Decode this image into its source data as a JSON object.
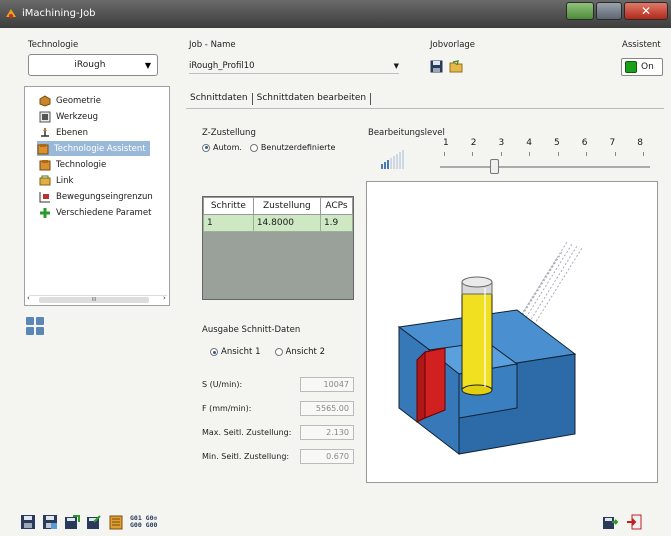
{
  "window": {
    "title": "iMachining-Job"
  },
  "technologie": {
    "label": "Technologie",
    "value": "iRough"
  },
  "job": {
    "label": "Job - Name",
    "value": "iRough_Profil10"
  },
  "jobvorlage": {
    "label": "Jobvorlage"
  },
  "assistent": {
    "label": "Assistent",
    "toggle_text": "On"
  },
  "tree": {
    "items": [
      {
        "label": "Geometrie",
        "icon": "geometry-icon"
      },
      {
        "label": "Werkzeug",
        "icon": "tool-icon"
      },
      {
        "label": "Ebenen",
        "icon": "planes-icon"
      },
      {
        "label": "Technologie Assistent",
        "icon": "tech-assistant-icon"
      },
      {
        "label": "Technologie",
        "icon": "technology-icon"
      },
      {
        "label": "Link",
        "icon": "link-icon"
      },
      {
        "label": "Bewegungseingrenzun",
        "icon": "motion-limit-icon"
      },
      {
        "label": "Verschiedene Paramet",
        "icon": "misc-params-icon"
      }
    ],
    "selected_index": 3,
    "scroll_label": "III"
  },
  "tabs": [
    {
      "label": "Schnittdaten"
    },
    {
      "label": "Schnittdaten bearbeiten"
    }
  ],
  "z_zustellung": {
    "label": "Z-Zustellung",
    "options": [
      "Autom.",
      "Benutzerdefinierte"
    ],
    "selected": "Autom."
  },
  "bearbeitungslevel": {
    "label": "Bearbeitungslevel",
    "levels": [
      "1",
      "2",
      "3",
      "4",
      "5",
      "6",
      "7",
      "8"
    ],
    "value": 3
  },
  "table": {
    "headers": [
      "Schritte",
      "Zustellung",
      "ACPs"
    ],
    "rows": [
      [
        "1",
        "14.8000",
        "1.9"
      ]
    ]
  },
  "ausgabe": {
    "label": "Ausgabe Schnitt-Daten",
    "options": [
      "Ansicht 1",
      "Ansicht 2"
    ],
    "selected": "Ansicht 1"
  },
  "fields": [
    {
      "label": "S (U/min):",
      "value": "10047"
    },
    {
      "label": "F (mm/min):",
      "value": "5565.00"
    },
    {
      "label": "Max. Seitl. Zustellung:",
      "value": "2.130"
    },
    {
      "label": "Min. Seitl. Zustellung:",
      "value": "0.670"
    }
  ],
  "gcode_labels": {
    "a": "G01",
    "b": "G00",
    "c": "G0",
    "d": "G00"
  }
}
